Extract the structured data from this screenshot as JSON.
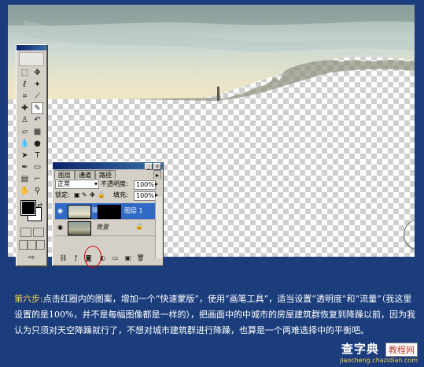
{
  "layers_panel": {
    "tabs": [
      "图层",
      "通道",
      "路径"
    ],
    "blend_mode": "正常",
    "opacity_label": "不透明度:",
    "opacity_value": "100%",
    "lock_label": "锁定:",
    "fill_label": "填充:",
    "fill_value": "100%",
    "layers": [
      {
        "name": "图层 1",
        "active": true
      },
      {
        "name": "背景",
        "active": false
      }
    ]
  },
  "toolbar": {
    "tools": [
      "marquee-tool",
      "move-tool",
      "lasso-tool",
      "magic-wand-tool",
      "crop-tool",
      "slice-tool",
      "healing-brush-tool",
      "brush-tool",
      "clone-stamp-tool",
      "history-brush-tool",
      "eraser-tool",
      "gradient-tool",
      "blur-tool",
      "dodge-tool",
      "path-selection-tool",
      "type-tool",
      "pen-tool",
      "shape-tool",
      "notes-tool",
      "eyedropper-tool",
      "hand-tool",
      "zoom-tool"
    ],
    "type_glyph": "T"
  },
  "caption": {
    "step": "第六步:",
    "text": "点击红圈内的图案，增加一个“快速蒙版”，使用“画笔工具”，适当设置“透明度”和“流量”（我这里设置的是100%，并不是每幅图像都是一样的），把画面中的中城市的房屋建筑群恢复到降躁以前，因为我认为只须对天空降躁就行了，不想对城市建筑群进行降躁，也算是一个两难选择中的平衡吧。"
  },
  "watermark": {
    "main": "查字典",
    "box": "教程网",
    "url": "jiaocheng.chazidian.com"
  },
  "colors": {
    "background": "#1b3d7c",
    "step": "#f7d34a",
    "active_layer": "#316ac5",
    "highlight": "#d40000"
  }
}
